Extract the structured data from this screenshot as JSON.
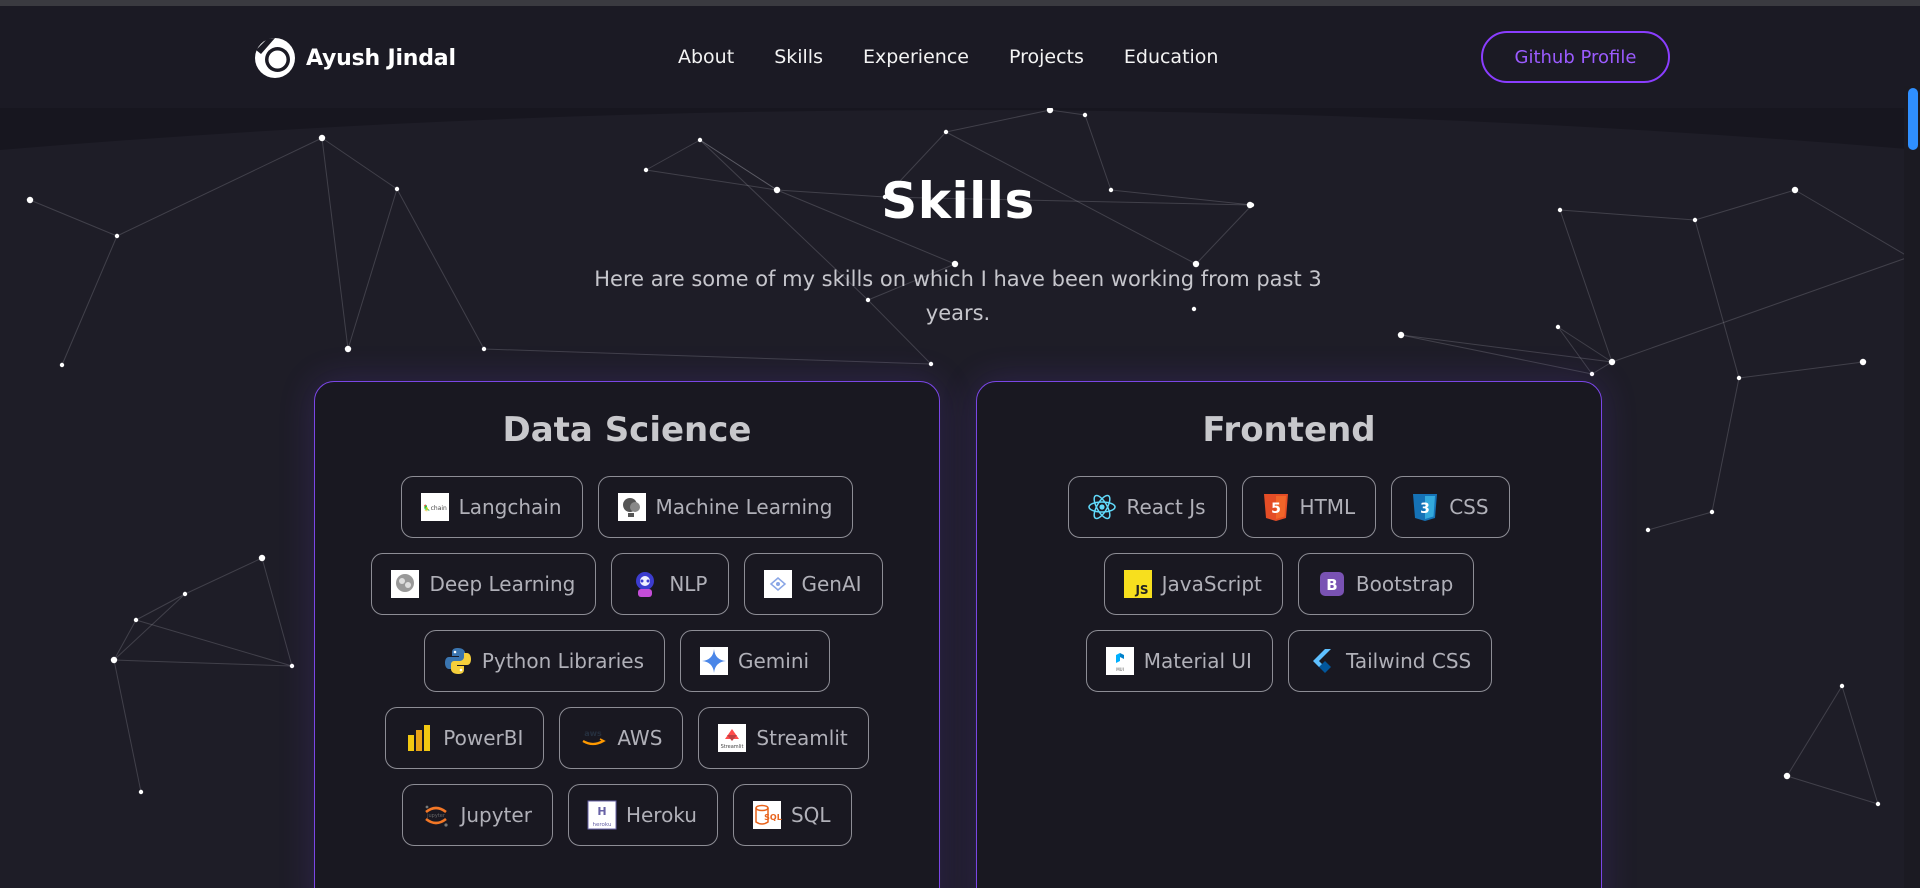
{
  "nav": {
    "brand": "Ayush Jindal",
    "links": [
      "About",
      "Skills",
      "Experience",
      "Projects",
      "Education"
    ],
    "cta": "Github Profile"
  },
  "skills": {
    "title": "Skills",
    "description": "Here are some of my skills on which I have been working from past 3 years."
  },
  "cards": [
    {
      "title": "Data Science",
      "rows": [
        [
          {
            "label": "Langchain",
            "icon": "langchain-icon"
          },
          {
            "label": "Machine Learning",
            "icon": "machine-learning-icon"
          }
        ],
        [
          {
            "label": "Deep Learning",
            "icon": "deep-learning-icon"
          },
          {
            "label": "NLP",
            "icon": "nlp-icon"
          },
          {
            "label": "GenAI",
            "icon": "genai-icon"
          }
        ],
        [
          {
            "label": "Python Libraries",
            "icon": "python-icon"
          },
          {
            "label": "Gemini",
            "icon": "gemini-icon"
          }
        ],
        [
          {
            "label": "PowerBI",
            "icon": "powerbi-icon"
          },
          {
            "label": "AWS",
            "icon": "aws-icon"
          },
          {
            "label": "Streamlit",
            "icon": "streamlit-icon"
          }
        ],
        [
          {
            "label": "Jupyter",
            "icon": "jupyter-icon"
          },
          {
            "label": "Heroku",
            "icon": "heroku-icon"
          },
          {
            "label": "SQL",
            "icon": "sql-icon"
          }
        ]
      ]
    },
    {
      "title": "Frontend",
      "rows": [
        [
          {
            "label": "React Js",
            "icon": "react-icon"
          },
          {
            "label": "HTML",
            "icon": "html5-icon"
          },
          {
            "label": "CSS",
            "icon": "css3-icon"
          }
        ],
        [
          {
            "label": "JavaScript",
            "icon": "javascript-icon"
          },
          {
            "label": "Bootstrap",
            "icon": "bootstrap-icon"
          }
        ],
        [
          {
            "label": "Material UI",
            "icon": "material-ui-icon"
          },
          {
            "label": "Tailwind CSS",
            "icon": "tailwind-icon"
          }
        ]
      ]
    }
  ],
  "colors": {
    "background": "#17161f",
    "accent": "#8a3dff",
    "card_border": "#7a46e6",
    "scroll_thumb": "#2f8fff"
  }
}
